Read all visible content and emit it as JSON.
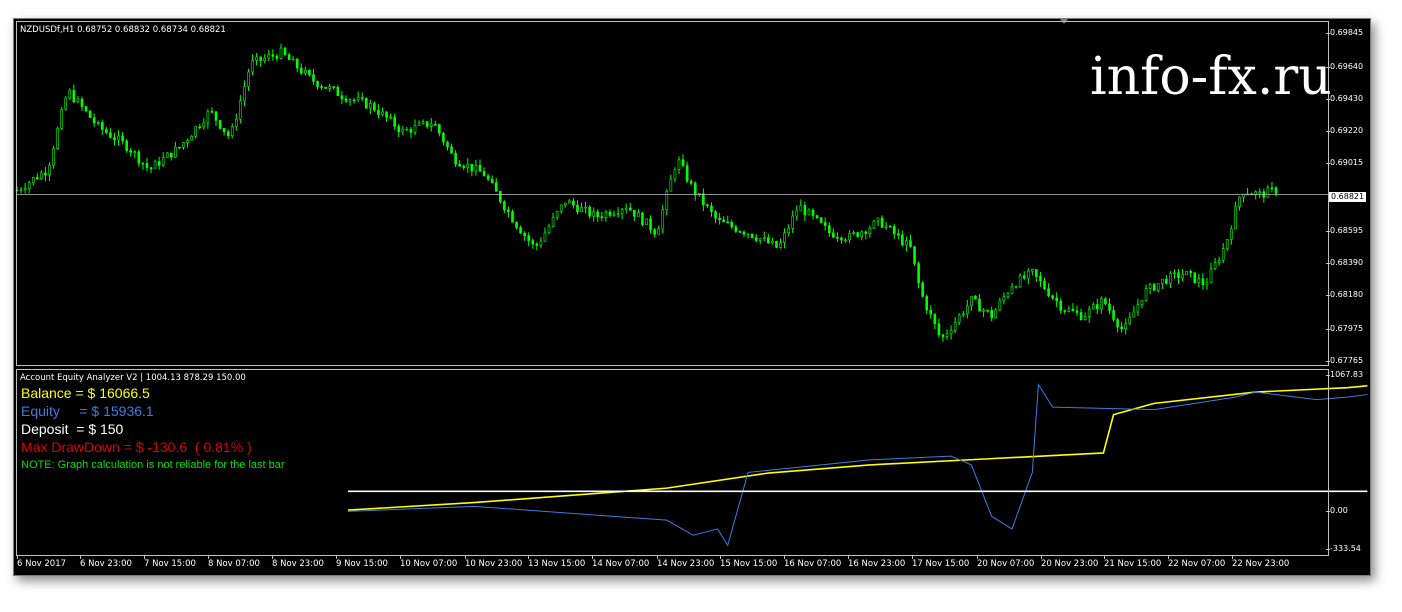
{
  "window": {
    "symbol_line": "NZDUSDf,H1  0.68752 0.68832 0.68734 0.68821",
    "watermark": "info-fx.ru"
  },
  "price_scale": {
    "labels": [
      "0.69845",
      "0.69640",
      "0.69430",
      "0.69220",
      "0.69015",
      "0.68595",
      "0.68390",
      "0.68180",
      "0.67975",
      "0.67765"
    ],
    "current_price": "0.68821"
  },
  "time_scale": {
    "labels": [
      "6 Nov 2017",
      "6 Nov 23:00",
      "7 Nov 15:00",
      "8 Nov 07:00",
      "8 Nov 23:00",
      "9 Nov 15:00",
      "10 Nov 07:00",
      "10 Nov 23:00",
      "13 Nov 15:00",
      "14 Nov 07:00",
      "14 Nov 23:00",
      "15 Nov 15:00",
      "16 Nov 07:00",
      "16 Nov 23:00",
      "17 Nov 15:00",
      "20 Nov 07:00",
      "20 Nov 23:00",
      "21 Nov 15:00",
      "22 Nov 07:00",
      "22 Nov 23:00"
    ]
  },
  "indicator": {
    "name_line": "Account Equity Analyzer V2  |  1004.13 878.29 150.00",
    "balance_text": "Balance = $ 16066.5",
    "equity_text": "Equity     = $ 15936.1",
    "deposit_text": "Deposit  = $ 150",
    "drawdown_text": "Max DrawDown = $ -130.6  ( 0.81% )",
    "note_text": "NOTE: Graph calculation is not reliable for the last bar",
    "scale_labels": [
      "1067.83",
      "0.00",
      "-333.54"
    ],
    "colors": {
      "balance": "#ffff00",
      "equity": "#3a7de0",
      "deposit": "#ffffff",
      "drawdown": "#e00000",
      "note": "#00e000"
    }
  },
  "chart_data": [
    {
      "type": "candlestick",
      "title": "NZDUSDf,H1",
      "ylim": [
        0.67765,
        0.69845
      ],
      "series": [
        {
          "name": "NZDUSDf",
          "color": "#00ff00"
        }
      ],
      "close_path": [
        [
          0,
          0.6885
        ],
        [
          15,
          0.6898
        ],
        [
          25,
          0.6948
        ],
        [
          40,
          0.6925
        ],
        [
          55,
          0.6912
        ],
        [
          65,
          0.6898
        ],
        [
          80,
          0.6912
        ],
        [
          95,
          0.6935
        ],
        [
          105,
          0.6918
        ],
        [
          115,
          0.6965
        ],
        [
          130,
          0.6972
        ],
        [
          145,
          0.6955
        ],
        [
          160,
          0.6945
        ],
        [
          175,
          0.6938
        ],
        [
          190,
          0.6922
        ],
        [
          205,
          0.6928
        ],
        [
          215,
          0.6905
        ],
        [
          230,
          0.6895
        ],
        [
          245,
          0.6865
        ],
        [
          255,
          0.6848
        ],
        [
          270,
          0.6878
        ],
        [
          285,
          0.6868
        ],
        [
          300,
          0.6875
        ],
        [
          315,
          0.6858
        ],
        [
          325,
          0.6905
        ],
        [
          333,
          0.6885
        ],
        [
          345,
          0.6865
        ],
        [
          360,
          0.6858
        ],
        [
          375,
          0.6848
        ],
        [
          385,
          0.6875
        ],
        [
          400,
          0.6858
        ],
        [
          410,
          0.6855
        ],
        [
          425,
          0.6865
        ],
        [
          440,
          0.6848
        ],
        [
          445,
          0.682
        ],
        [
          455,
          0.679
        ],
        [
          470,
          0.6815
        ],
        [
          480,
          0.6805
        ],
        [
          490,
          0.6825
        ],
        [
          500,
          0.6832
        ],
        [
          515,
          0.681
        ],
        [
          525,
          0.6805
        ],
        [
          535,
          0.6815
        ],
        [
          545,
          0.6795
        ],
        [
          555,
          0.682
        ],
        [
          565,
          0.6828
        ],
        [
          575,
          0.6832
        ],
        [
          585,
          0.6825
        ],
        [
          595,
          0.685
        ],
        [
          603,
          0.6885
        ],
        [
          612,
          0.6882
        ],
        [
          620,
          0.6885
        ]
      ],
      "current_price": 0.68821
    },
    {
      "type": "line",
      "title": "Account Equity Analyzer V2",
      "ylim": [
        -333.54,
        1067.83
      ],
      "series": [
        {
          "name": "Balance",
          "color": "#ffff00",
          "points": [
            [
              163,
              0
            ],
            [
              225,
              60
            ],
            [
              320,
              175
            ],
            [
              370,
              295
            ],
            [
              420,
              360
            ],
            [
              480,
              410
            ],
            [
              535,
              455
            ],
            [
              540,
              760
            ],
            [
              560,
              850
            ],
            [
              610,
              940
            ],
            [
              655,
              975
            ],
            [
              665,
              990
            ]
          ]
        },
        {
          "name": "Equity",
          "color": "#3a7de0",
          "points": [
            [
              163,
              -10
            ],
            [
              225,
              30
            ],
            [
              320,
              -80
            ],
            [
              333,
              -200
            ],
            [
              345,
              -150
            ],
            [
              350,
              -280
            ],
            [
              360,
              300
            ],
            [
              420,
              400
            ],
            [
              460,
              430
            ],
            [
              470,
              360
            ],
            [
              480,
              -50
            ],
            [
              490,
              -150
            ],
            [
              500,
              300
            ],
            [
              503,
              1000
            ],
            [
              510,
              820
            ],
            [
              560,
              800
            ],
            [
              600,
              900
            ],
            [
              610,
              940
            ],
            [
              640,
              880
            ],
            [
              655,
              900
            ],
            [
              665,
              920
            ]
          ]
        },
        {
          "name": "Deposit",
          "color": "#ffffff",
          "points": [
            [
              163,
              150
            ],
            [
              665,
              150
            ]
          ]
        }
      ]
    }
  ]
}
